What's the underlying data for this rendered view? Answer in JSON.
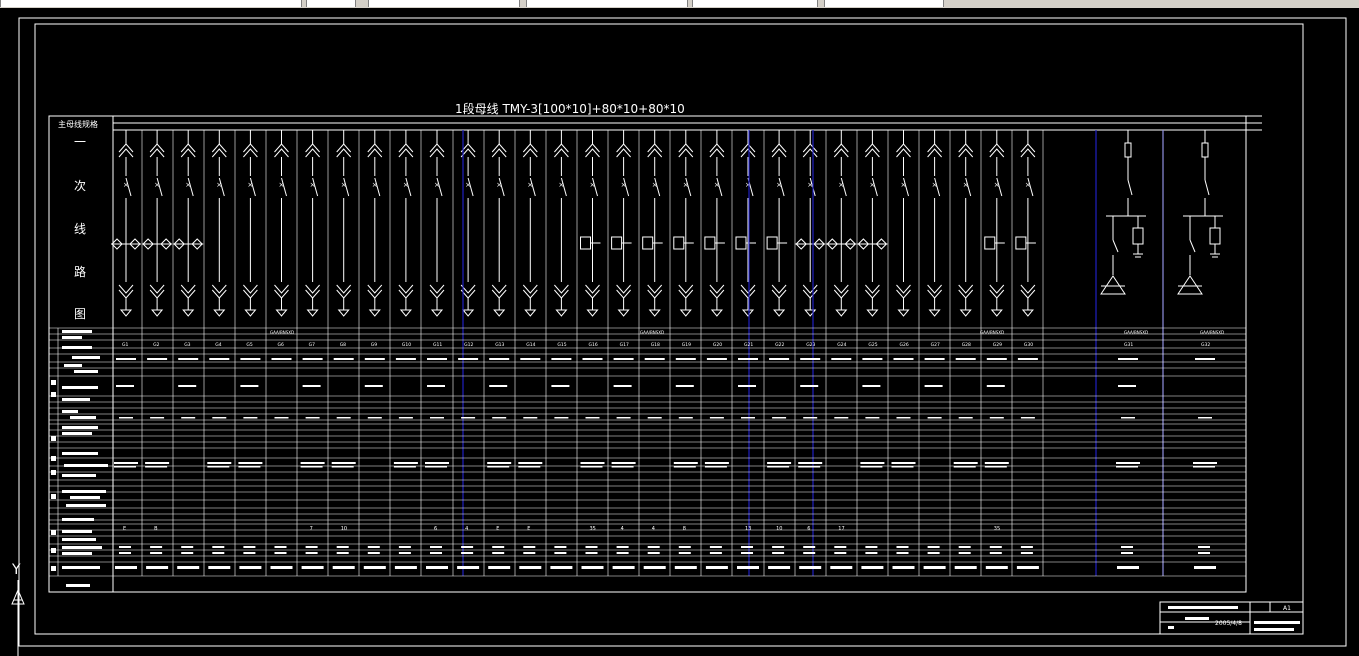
{
  "window": {
    "toolbar_segments": [
      "",
      "",
      "",
      "",
      "",
      ""
    ]
  },
  "drawing": {
    "bus_title": "1段母线   TMY-3[100*10]+80*10+80*10",
    "row_header_busbar": "主母线规格",
    "vertical_label_chars": [
      "一",
      "次",
      "线",
      "路",
      "图"
    ],
    "ucs_y_label": "Y",
    "sheet_size": "A1",
    "title_date": "2005/4/8",
    "colors": {
      "background": "#000000",
      "lines": "#ffffff",
      "section_divider": "#2020c0",
      "toolbar": "#d4d0c8"
    },
    "group_headers": [
      "GAA/BNSXD",
      "GAA/BNSXD",
      "GAA/BNSXD",
      "GAA/BNSXD",
      "GAA/BNSXD"
    ],
    "cabinet_numbers": [
      "G1",
      "G2",
      "G3",
      "G4",
      "G5",
      "G6",
      "G7",
      "G8",
      "G9",
      "G10",
      "G11",
      "G12",
      "G13",
      "G14",
      "G15",
      "G16",
      "G17",
      "G18",
      "G19",
      "G20",
      "G21",
      "G22",
      "G23",
      "G24",
      "G25",
      "G26",
      "G27",
      "G28",
      "G29",
      "G30",
      "G31",
      "G32"
    ],
    "power_values": [
      "E",
      "B",
      "",
      "",
      "",
      "",
      "7",
      "10",
      "",
      "",
      "6",
      "4",
      "E",
      "E",
      "",
      "35",
      "4",
      "4",
      "8",
      "",
      "13",
      "10",
      "6",
      "17",
      "",
      "",
      "",
      "",
      "35",
      "",
      "",
      ""
    ],
    "symbol_types": [
      "switch-fuse",
      "switch-fuse",
      "switch-fuse",
      "switch",
      "switch",
      "switch",
      "switch",
      "switch",
      "switch",
      "switch",
      "switch",
      "switch",
      "switch",
      "switch",
      "switch",
      "contactor",
      "contactor",
      "contactor",
      "contactor",
      "contactor",
      "contactor",
      "contactor",
      "switch-fuse",
      "switch-fuse",
      "switch-fuse",
      "switch",
      "switch",
      "switch",
      "contactor",
      "contactor",
      "metering",
      "metering"
    ]
  }
}
